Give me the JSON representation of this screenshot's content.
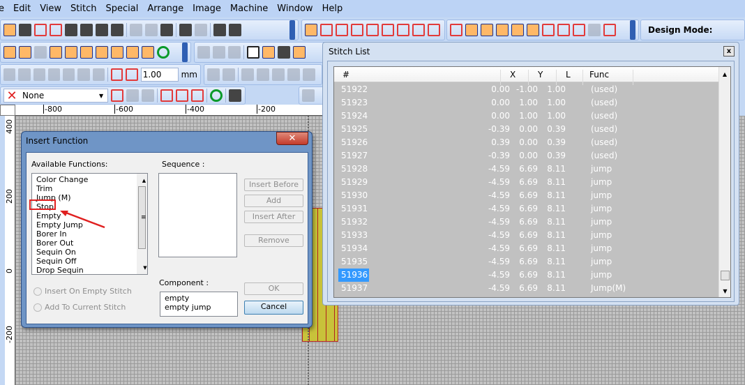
{
  "menu": [
    "e",
    "Edit",
    "View",
    "Stitch",
    "Special",
    "Arrange",
    "Image",
    "Machine",
    "Window",
    "Help"
  ],
  "toolbar": {
    "design_mode_label": "Design Mode:",
    "spacing_value": "1.00",
    "spacing_unit": "mm",
    "color_select": "None"
  },
  "ruler": {
    "top": [
      "-800",
      "-600",
      "-400",
      "-200"
    ],
    "left": [
      "400",
      "200",
      "0",
      "-200"
    ]
  },
  "insert_function": {
    "title": "Insert Function",
    "close": "✕",
    "available_label": "Available Functions:",
    "functions": [
      "Color Change",
      "Trim",
      "Jump (M)",
      "Stop",
      "Empty",
      "Empty Jump",
      "Borer In",
      "Borer Out",
      "Sequin On",
      "Sequin Off",
      "Drop Sequin"
    ],
    "highlighted": "Stop",
    "sequence_label": "Sequence :",
    "buttons": {
      "insert_before": "Insert Before",
      "add": "Add",
      "insert_after": "Insert After",
      "remove": "Remove",
      "ok": "OK",
      "cancel": "Cancel"
    },
    "radio_empty": "Insert On Empty Stitch",
    "radio_current": "Add To Current Stitch",
    "component_label": "Component :",
    "components": [
      "empty",
      "empty jump"
    ]
  },
  "stitch_list": {
    "title": "Stitch List",
    "close": "x",
    "columns": [
      "#",
      "X",
      "Y",
      "L",
      "Func"
    ],
    "selected": "51936",
    "rows": [
      [
        "51922",
        "0.00",
        "-1.00",
        "1.00",
        "(used)"
      ],
      [
        "51923",
        "0.00",
        "1.00",
        "1.00",
        "(used)"
      ],
      [
        "51924",
        "0.00",
        "1.00",
        "1.00",
        "(used)"
      ],
      [
        "51925",
        "-0.39",
        "0.00",
        "0.39",
        "(used)"
      ],
      [
        "51926",
        "0.39",
        "0.00",
        "0.39",
        "(used)"
      ],
      [
        "51927",
        "-0.39",
        "0.00",
        "0.39",
        "(used)"
      ],
      [
        "51928",
        "-4.59",
        "6.69",
        "8.11",
        "jump"
      ],
      [
        "51929",
        "-4.59",
        "6.69",
        "8.11",
        "jump"
      ],
      [
        "51930",
        "-4.59",
        "6.69",
        "8.11",
        "jump"
      ],
      [
        "51931",
        "-4.59",
        "6.69",
        "8.11",
        "jump"
      ],
      [
        "51932",
        "-4.59",
        "6.69",
        "8.11",
        "jump"
      ],
      [
        "51933",
        "-4.59",
        "6.69",
        "8.11",
        "jump"
      ],
      [
        "51934",
        "-4.59",
        "6.69",
        "8.11",
        "jump"
      ],
      [
        "51935",
        "-4.59",
        "6.69",
        "8.11",
        "jump"
      ],
      [
        "51936",
        "-4.59",
        "6.69",
        "8.11",
        "jump"
      ],
      [
        "51937",
        "-4.59",
        "6.69",
        "8.11",
        "Jump(M)"
      ]
    ]
  },
  "colors": {
    "accent": "#3399ff",
    "highlight_box": "#e02020"
  }
}
